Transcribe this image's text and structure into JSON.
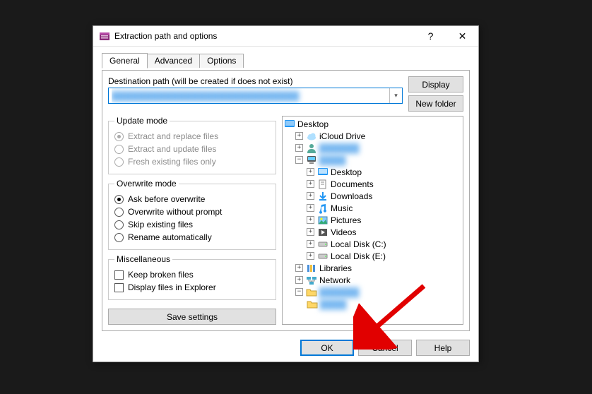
{
  "window": {
    "title": "Extraction path and options",
    "help": "?",
    "close": "✕"
  },
  "tabs": {
    "general": "General",
    "advanced": "Advanced",
    "options": "Options"
  },
  "path": {
    "label": "Destination path (will be created if does not exist)",
    "value": "████████████████████████████",
    "display_btn": "Display",
    "newfolder_btn": "New folder"
  },
  "update": {
    "legend": "Update mode",
    "opt1": "Extract and replace files",
    "opt2": "Extract and update files",
    "opt3": "Fresh existing files only"
  },
  "overwrite": {
    "legend": "Overwrite mode",
    "opt1": "Ask before overwrite",
    "opt2": "Overwrite without prompt",
    "opt3": "Skip existing files",
    "opt4": "Rename automatically"
  },
  "misc": {
    "legend": "Miscellaneous",
    "opt1": "Keep broken files",
    "opt2": "Display files in Explorer"
  },
  "save": "Save settings",
  "tree": {
    "desktop": "Desktop",
    "icloud": "iCloud Drive",
    "blur1": "██████",
    "blur2": "████",
    "sub_desktop": "Desktop",
    "documents": "Documents",
    "downloads": "Downloads",
    "music": "Music",
    "pictures": "Pictures",
    "videos": "Videos",
    "disk_c": "Local Disk (C:)",
    "disk_e": "Local Disk (E:)",
    "libraries": "Libraries",
    "network": "Network",
    "blur3": "██████"
  },
  "buttons": {
    "ok": "OK",
    "cancel": "Cancel",
    "help": "Help"
  }
}
